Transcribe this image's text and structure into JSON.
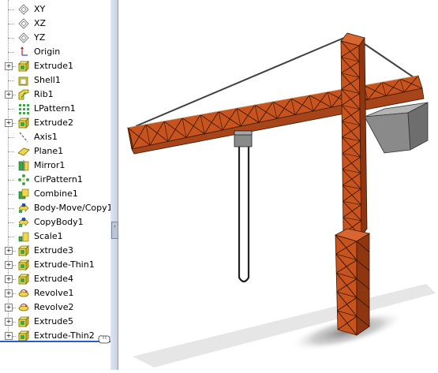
{
  "feature_tree": {
    "items": [
      {
        "label": "XY",
        "icon": "plane-icon",
        "expandable": false
      },
      {
        "label": "XZ",
        "icon": "plane-icon",
        "expandable": false
      },
      {
        "label": "YZ",
        "icon": "plane-icon",
        "expandable": false
      },
      {
        "label": "Origin",
        "icon": "origin-icon",
        "expandable": false
      },
      {
        "label": "Extrude1",
        "icon": "extrude-icon",
        "expandable": true
      },
      {
        "label": "Shell1",
        "icon": "shell-icon",
        "expandable": false
      },
      {
        "label": "Rib1",
        "icon": "rib-icon",
        "expandable": true
      },
      {
        "label": "LPattern1",
        "icon": "linear-pattern-icon",
        "expandable": false
      },
      {
        "label": "Extrude2",
        "icon": "extrude-icon",
        "expandable": true
      },
      {
        "label": "Axis1",
        "icon": "axis-icon",
        "expandable": false
      },
      {
        "label": "Plane1",
        "icon": "plane-feature-icon",
        "expandable": false
      },
      {
        "label": "Mirror1",
        "icon": "mirror-icon",
        "expandable": false
      },
      {
        "label": "CirPattern1",
        "icon": "circular-pattern-icon",
        "expandable": false
      },
      {
        "label": "Combine1",
        "icon": "combine-icon",
        "expandable": false
      },
      {
        "label": "Body-Move/Copy1",
        "icon": "move-copy-icon",
        "expandable": false
      },
      {
        "label": "CopyBody1",
        "icon": "move-copy-icon",
        "expandable": false
      },
      {
        "label": "Scale1",
        "icon": "scale-icon",
        "expandable": false
      },
      {
        "label": "Extrude3",
        "icon": "extrude-icon",
        "expandable": true
      },
      {
        "label": "Extrude-Thin1",
        "icon": "extrude-icon",
        "expandable": true
      },
      {
        "label": "Extrude4",
        "icon": "extrude-icon",
        "expandable": true
      },
      {
        "label": "Revolve1",
        "icon": "revolve-icon",
        "expandable": true
      },
      {
        "label": "Revolve2",
        "icon": "revolve-icon",
        "expandable": true
      },
      {
        "label": "Extrude5",
        "icon": "extrude-icon",
        "expandable": true
      },
      {
        "label": "Extrude-Thin2",
        "icon": "extrude-icon",
        "expandable": true
      }
    ],
    "expand_glyph": "+"
  },
  "splitter": {
    "arrow_glyph": "‹"
  },
  "model": {
    "description_name": "tower-crane-model",
    "truss_color": "#c8531c",
    "counterweight_color": "#8a8a8a",
    "cable_color": "#404040",
    "shadow_color": "#bdbdbd"
  },
  "colors": {
    "rollback_bar": "#2a5bd7",
    "tree_background": "#ffffff"
  }
}
